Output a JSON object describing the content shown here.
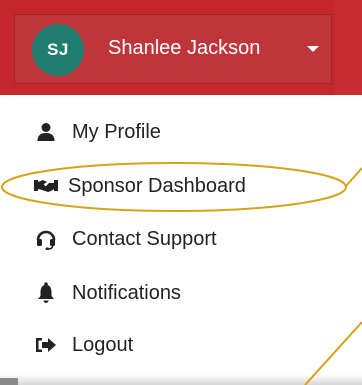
{
  "user": {
    "initials": "SJ",
    "name": "Shanlee Jackson"
  },
  "menu": {
    "items": [
      {
        "label": "My Profile",
        "icon": "user-icon"
      },
      {
        "label": "Sponsor Dashboard",
        "icon": "handshake-icon"
      },
      {
        "label": "Contact Support",
        "icon": "headset-icon"
      },
      {
        "label": "Notifications",
        "icon": "bell-icon"
      },
      {
        "label": "Logout",
        "icon": "sign-out-icon"
      }
    ]
  },
  "colors": {
    "header_red": "#c4272e",
    "avatar_teal": "#1f7d6e",
    "annotation_gold": "#d4a417"
  }
}
